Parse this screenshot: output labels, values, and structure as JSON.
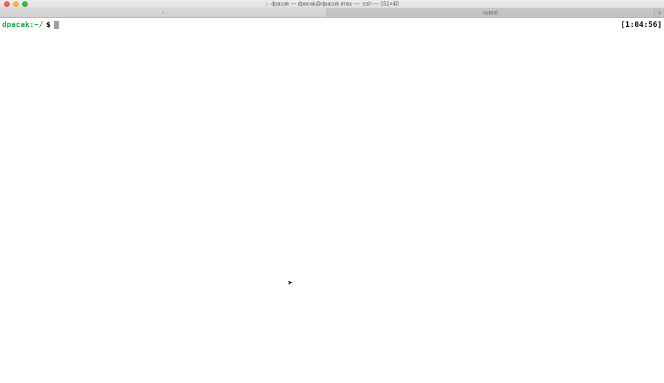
{
  "window": {
    "title": "dpacak — dpacak@dpacak-imac — -zsh — 151×40"
  },
  "tabs": {
    "active_label": "-",
    "inactive_label": "octant",
    "new_tab_symbol": "+"
  },
  "prompt": {
    "user_host": "dpacak:",
    "cwd_tilde": "~",
    "cwd_slash": "/",
    "symbol": "$"
  },
  "clock": "[1:04:56]"
}
